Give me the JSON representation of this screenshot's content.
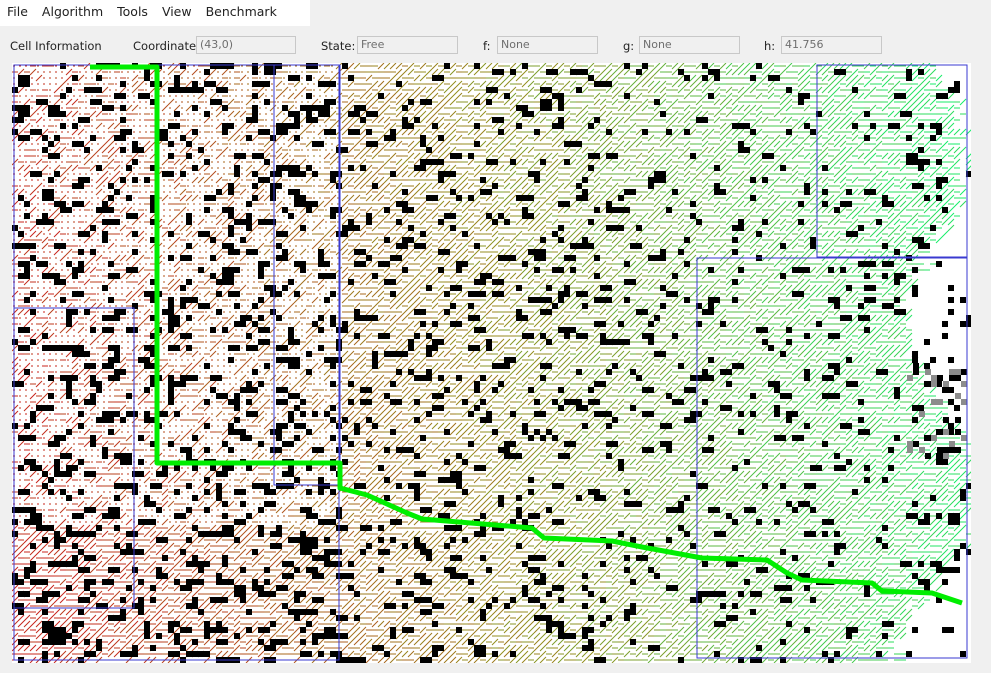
{
  "menu": [
    {
      "id": "file",
      "label": "File"
    },
    {
      "id": "algorithm",
      "label": "Algorithm"
    },
    {
      "id": "tools",
      "label": "Tools"
    },
    {
      "id": "view",
      "label": "View"
    },
    {
      "id": "benchmark",
      "label": "Benchmark"
    }
  ],
  "cell_info": {
    "title": "Cell Information",
    "coordinate": {
      "label": "Coordinate:",
      "value": "(43,0)"
    },
    "state": {
      "label": "State:",
      "value": "Free"
    },
    "f": {
      "label": "f:",
      "value": "None"
    },
    "g": {
      "label": "g:",
      "value": "None"
    },
    "h": {
      "label": "h:",
      "value": "41.756"
    }
  },
  "grid_view": {
    "background": "#ffffff",
    "obstacle_color": "#000000",
    "path_color": "#00ee00",
    "heat_start_color": "#c8261e",
    "heat_end_color": "#00ff78",
    "region_border_color": "#3a3ad0"
  }
}
